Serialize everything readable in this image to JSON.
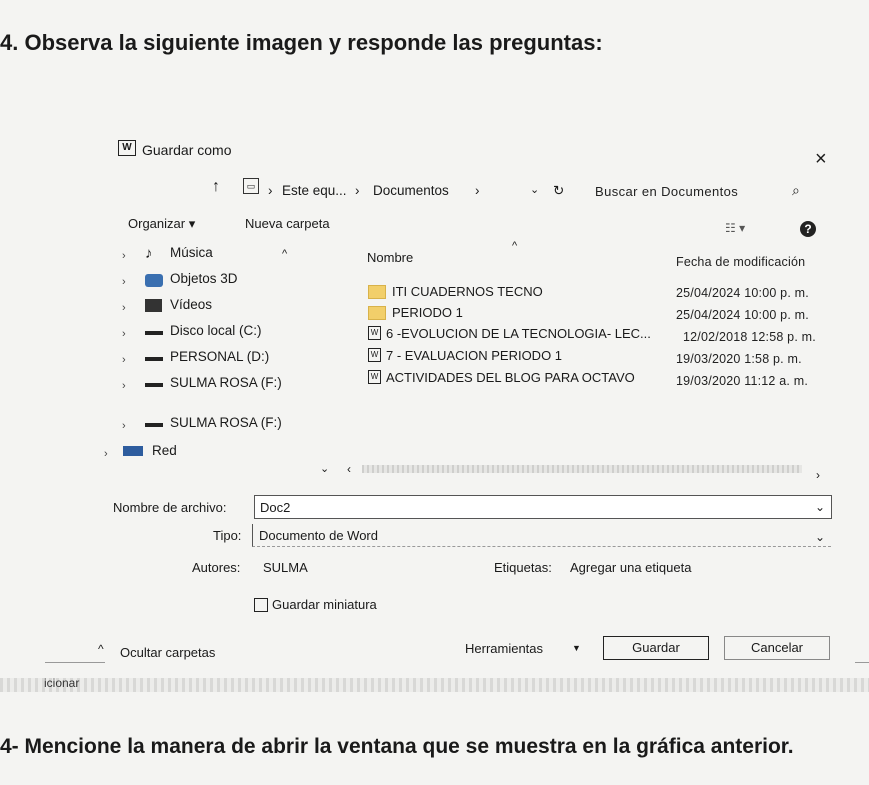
{
  "question_header": "4. Observa la siguiente imagen y responde las preguntas:",
  "dialog": {
    "title": "Guardar como",
    "app_icon_letter": "W",
    "close_glyph": "×",
    "breadcrumb": [
      "Este equ...",
      "Documentos"
    ],
    "search_placeholder": "Buscar en Documentos",
    "toolbar": {
      "organize": "Organizar",
      "new_folder": "Nueva carpeta"
    },
    "nav_tree": [
      "Música",
      "Objetos 3D",
      "Vídeos",
      "Disco local (C:)",
      "PERSONAL (D:)",
      "SULMA ROSA (F:)",
      "SULMA ROSA (F:)",
      "Red"
    ],
    "columns": {
      "name": "Nombre",
      "modified": "Fecha de modificación"
    },
    "files": [
      {
        "name": "ITI CUADERNOS TECNO",
        "date": "25/04/2024 10:00 p. m.",
        "icon": "folder-icon"
      },
      {
        "name": "PERIODO 1",
        "date": "25/04/2024 10:00 p. m.",
        "icon": "folder-icon"
      },
      {
        "name": "6 -EVOLUCION DE LA TECNOLOGIA- LEC...",
        "date": "12/02/2018 12:58 p. m.",
        "icon": "word-doc-icon"
      },
      {
        "name": "7 - EVALUACION PERIODO 1",
        "date": "19/03/2020 1:58 p. m.",
        "icon": "word-doc-icon"
      },
      {
        "name": "ACTIVIDADES DEL BLOG PARA OCTAVO",
        "date": "19/03/2020 11:12 a. m.",
        "icon": "word-doc-icon"
      }
    ],
    "filename_label": "Nombre de archivo:",
    "filename_value": "Doc2",
    "type_label": "Tipo:",
    "type_value": "Documento de Word",
    "authors_label": "Autores:",
    "authors_value": "SULMA",
    "tags_label": "Etiquetas:",
    "tags_value": "Agregar una etiqueta",
    "thumbnail_label": "Guardar miniatura",
    "hide_folders": "Ocultar carpetas",
    "tools": "Herramientas",
    "save": "Guardar",
    "cancel": "Cancelar"
  },
  "partial_text": "icionar",
  "footer_question": "4- Mencione la manera  de abrir la ventana que se muestra en la gráfica anterior."
}
